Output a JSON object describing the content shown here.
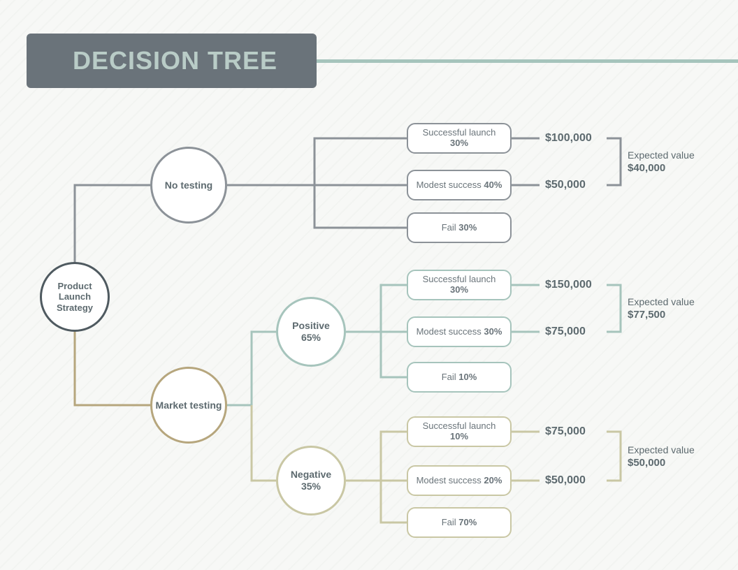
{
  "title": "DECISION TREE",
  "root": {
    "label": "Product Launch Strategy"
  },
  "branches": {
    "no_testing": {
      "label": "No testing",
      "outcomes": [
        {
          "label": "Successful launch",
          "pct": "30%",
          "value": "$100,000"
        },
        {
          "label": "Modest success",
          "pct": "40%",
          "value": "$50,000"
        },
        {
          "label": "Fail",
          "pct": "30%"
        }
      ],
      "expected": {
        "label": "Expected value",
        "value": "$40,000"
      }
    },
    "market_testing": {
      "label": "Market testing",
      "positive": {
        "label": "Positive",
        "pct": "65%",
        "outcomes": [
          {
            "label": "Successful launch",
            "pct": "30%",
            "value": "$150,000"
          },
          {
            "label": "Modest success",
            "pct": "30%",
            "value": "$75,000"
          },
          {
            "label": "Fail",
            "pct": "10%"
          }
        ],
        "expected": {
          "label": "Expected value",
          "value": "$77,500"
        }
      },
      "negative": {
        "label": "Negative",
        "pct": "35%",
        "outcomes": [
          {
            "label": "Successful launch",
            "pct": "10%",
            "value": "$75,000"
          },
          {
            "label": "Modest success",
            "pct": "20%",
            "value": "$50,000"
          },
          {
            "label": "Fail",
            "pct": "70%"
          }
        ],
        "expected": {
          "label": "Expected value",
          "value": "$50,000"
        }
      }
    }
  }
}
